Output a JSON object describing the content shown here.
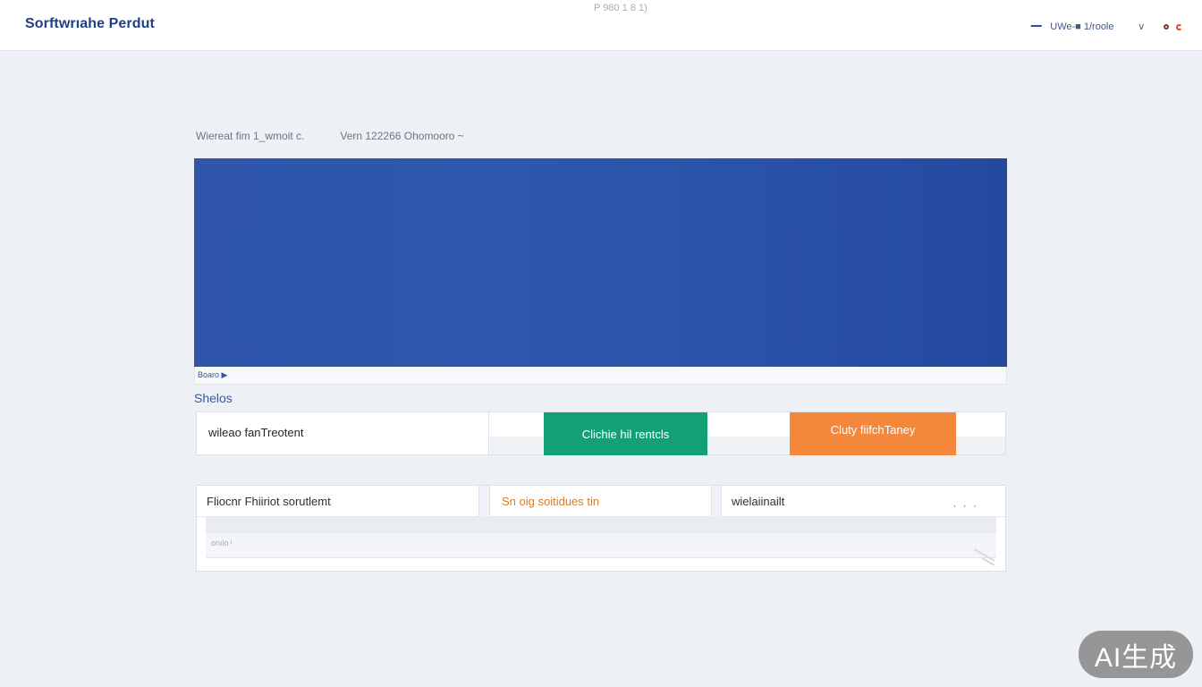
{
  "header": {
    "brand": "Sorftwrıahe Perdut",
    "center_code": "P 980 1 8 1)",
    "user_label": "UWe-■ 1/roole",
    "chevron": "v"
  },
  "breadcrumbs": [
    "Wiereat fim 1_wmoit c.",
    "Vern 122266 Ohomooro ~"
  ],
  "hero": {
    "caption": "Boaro ▶"
  },
  "section": {
    "title": "Shelos"
  },
  "status_row": {
    "label": "wileao fanTreotent",
    "green_button": "Clichie hil rentcls",
    "orange_button": "Cluty fiifchTaney"
  },
  "panel": {
    "tab1": "Fliocnr Fhiiriot sorutlemt",
    "tab2": "Sn oig soitidues tin",
    "tab3": "wielaiinailt",
    "more": "· · ·",
    "body_text": "onılo ᴵ"
  },
  "watermark": "AI生成",
  "colors": {
    "brand": "#1f3f86",
    "hero_blue": "#2d58ad",
    "green": "#12a074",
    "orange": "#f5873a"
  }
}
